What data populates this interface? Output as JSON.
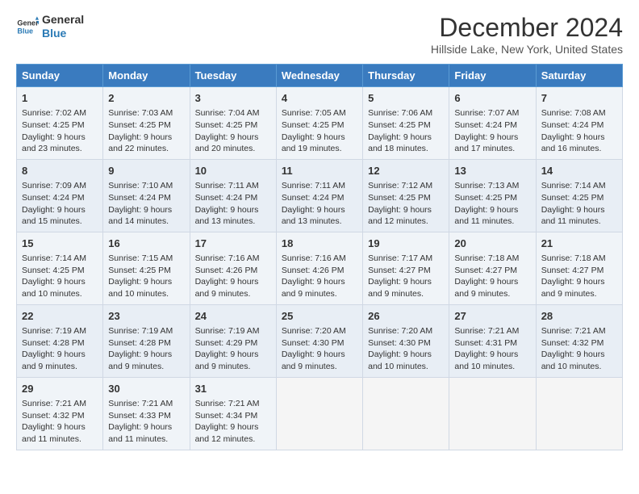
{
  "logo": {
    "line1": "General",
    "line2": "Blue"
  },
  "title": "December 2024",
  "location": "Hillside Lake, New York, United States",
  "days_of_week": [
    "Sunday",
    "Monday",
    "Tuesday",
    "Wednesday",
    "Thursday",
    "Friday",
    "Saturday"
  ],
  "weeks": [
    [
      {
        "day": "1",
        "sunrise": "7:02 AM",
        "sunset": "4:25 PM",
        "daylight": "9 hours and 23 minutes."
      },
      {
        "day": "2",
        "sunrise": "7:03 AM",
        "sunset": "4:25 PM",
        "daylight": "9 hours and 22 minutes."
      },
      {
        "day": "3",
        "sunrise": "7:04 AM",
        "sunset": "4:25 PM",
        "daylight": "9 hours and 20 minutes."
      },
      {
        "day": "4",
        "sunrise": "7:05 AM",
        "sunset": "4:25 PM",
        "daylight": "9 hours and 19 minutes."
      },
      {
        "day": "5",
        "sunrise": "7:06 AM",
        "sunset": "4:25 PM",
        "daylight": "9 hours and 18 minutes."
      },
      {
        "day": "6",
        "sunrise": "7:07 AM",
        "sunset": "4:24 PM",
        "daylight": "9 hours and 17 minutes."
      },
      {
        "day": "7",
        "sunrise": "7:08 AM",
        "sunset": "4:24 PM",
        "daylight": "9 hours and 16 minutes."
      }
    ],
    [
      {
        "day": "8",
        "sunrise": "7:09 AM",
        "sunset": "4:24 PM",
        "daylight": "9 hours and 15 minutes."
      },
      {
        "day": "9",
        "sunrise": "7:10 AM",
        "sunset": "4:24 PM",
        "daylight": "9 hours and 14 minutes."
      },
      {
        "day": "10",
        "sunrise": "7:11 AM",
        "sunset": "4:24 PM",
        "daylight": "9 hours and 13 minutes."
      },
      {
        "day": "11",
        "sunrise": "7:11 AM",
        "sunset": "4:24 PM",
        "daylight": "9 hours and 13 minutes."
      },
      {
        "day": "12",
        "sunrise": "7:12 AM",
        "sunset": "4:25 PM",
        "daylight": "9 hours and 12 minutes."
      },
      {
        "day": "13",
        "sunrise": "7:13 AM",
        "sunset": "4:25 PM",
        "daylight": "9 hours and 11 minutes."
      },
      {
        "day": "14",
        "sunrise": "7:14 AM",
        "sunset": "4:25 PM",
        "daylight": "9 hours and 11 minutes."
      }
    ],
    [
      {
        "day": "15",
        "sunrise": "7:14 AM",
        "sunset": "4:25 PM",
        "daylight": "9 hours and 10 minutes."
      },
      {
        "day": "16",
        "sunrise": "7:15 AM",
        "sunset": "4:25 PM",
        "daylight": "9 hours and 10 minutes."
      },
      {
        "day": "17",
        "sunrise": "7:16 AM",
        "sunset": "4:26 PM",
        "daylight": "9 hours and 9 minutes."
      },
      {
        "day": "18",
        "sunrise": "7:16 AM",
        "sunset": "4:26 PM",
        "daylight": "9 hours and 9 minutes."
      },
      {
        "day": "19",
        "sunrise": "7:17 AM",
        "sunset": "4:27 PM",
        "daylight": "9 hours and 9 minutes."
      },
      {
        "day": "20",
        "sunrise": "7:18 AM",
        "sunset": "4:27 PM",
        "daylight": "9 hours and 9 minutes."
      },
      {
        "day": "21",
        "sunrise": "7:18 AM",
        "sunset": "4:27 PM",
        "daylight": "9 hours and 9 minutes."
      }
    ],
    [
      {
        "day": "22",
        "sunrise": "7:19 AM",
        "sunset": "4:28 PM",
        "daylight": "9 hours and 9 minutes."
      },
      {
        "day": "23",
        "sunrise": "7:19 AM",
        "sunset": "4:28 PM",
        "daylight": "9 hours and 9 minutes."
      },
      {
        "day": "24",
        "sunrise": "7:19 AM",
        "sunset": "4:29 PM",
        "daylight": "9 hours and 9 minutes."
      },
      {
        "day": "25",
        "sunrise": "7:20 AM",
        "sunset": "4:30 PM",
        "daylight": "9 hours and 9 minutes."
      },
      {
        "day": "26",
        "sunrise": "7:20 AM",
        "sunset": "4:30 PM",
        "daylight": "9 hours and 10 minutes."
      },
      {
        "day": "27",
        "sunrise": "7:21 AM",
        "sunset": "4:31 PM",
        "daylight": "9 hours and 10 minutes."
      },
      {
        "day": "28",
        "sunrise": "7:21 AM",
        "sunset": "4:32 PM",
        "daylight": "9 hours and 10 minutes."
      }
    ],
    [
      {
        "day": "29",
        "sunrise": "7:21 AM",
        "sunset": "4:32 PM",
        "daylight": "9 hours and 11 minutes."
      },
      {
        "day": "30",
        "sunrise": "7:21 AM",
        "sunset": "4:33 PM",
        "daylight": "9 hours and 11 minutes."
      },
      {
        "day": "31",
        "sunrise": "7:21 AM",
        "sunset": "4:34 PM",
        "daylight": "9 hours and 12 minutes."
      },
      null,
      null,
      null,
      null
    ]
  ],
  "labels": {
    "sunrise": "Sunrise:",
    "sunset": "Sunset:",
    "daylight": "Daylight:"
  }
}
